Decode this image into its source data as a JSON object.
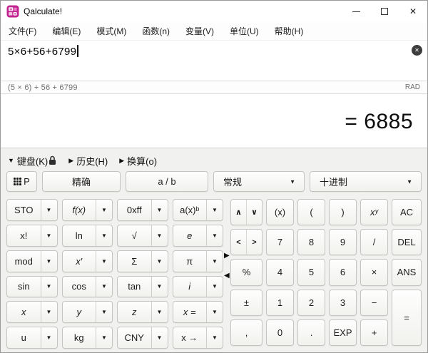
{
  "window": {
    "title": "Qalculate!",
    "controls": {
      "minimize": "–",
      "maximize": "□",
      "close": "✕"
    }
  },
  "menu": [
    "文件(F)",
    "编辑(E)",
    "模式(M)",
    "函数(n)",
    "变量(V)",
    "单位(U)",
    "帮助(H)"
  ],
  "input": {
    "value": "5×6+56+6799",
    "clear_glyph": "✕"
  },
  "statusbar": {
    "parsed": "(5 × 6) + 56 + 6799",
    "angle_mode": "RAD"
  },
  "result": {
    "value": "= 6885"
  },
  "panel": {
    "keyboard_toggle": "键盘(K)",
    "history_toggle": "历史(H)",
    "convert_toggle": "换算(o)"
  },
  "icons": {
    "dropdown_arrow": "▼",
    "expanded_arrow": "▼",
    "collapsed_arrow": "▶",
    "panel_expand_right": "▶",
    "panel_expand_left": "◀"
  },
  "mode_row": {
    "keypad_label": "P",
    "exact": "精确",
    "fraction": "a / b",
    "format": "常规",
    "base": "十进制"
  },
  "left_keypad": [
    {
      "name": "sto",
      "label": "STO"
    },
    {
      "name": "function",
      "label": "f(x)",
      "italic": true
    },
    {
      "name": "hex",
      "label": "0xff"
    },
    {
      "name": "exp-base",
      "label": "a(x)ᵇ"
    },
    {
      "name": "factorial",
      "label": "x!"
    },
    {
      "name": "ln",
      "label": "ln"
    },
    {
      "name": "sqrt",
      "label": "√"
    },
    {
      "name": "e",
      "label": "e",
      "italic": true
    },
    {
      "name": "mod",
      "label": "mod"
    },
    {
      "name": "derivative",
      "label": "x′",
      "italic": true
    },
    {
      "name": "sum",
      "label": "Σ"
    },
    {
      "name": "pi",
      "label": "π"
    },
    {
      "name": "sin",
      "label": "sin"
    },
    {
      "name": "cos",
      "label": "cos"
    },
    {
      "name": "tan",
      "label": "tan"
    },
    {
      "name": "imaginary",
      "label": "i",
      "italic": true
    },
    {
      "name": "var-x",
      "label": "x",
      "italic": true
    },
    {
      "name": "var-y",
      "label": "y",
      "italic": true
    },
    {
      "name": "var-z",
      "label": "z",
      "italic": true
    },
    {
      "name": "solve",
      "label": "x =",
      "italic": true
    },
    {
      "name": "unit-u",
      "label": "u"
    },
    {
      "name": "unit-kg",
      "label": "kg"
    },
    {
      "name": "currency-cny",
      "label": "CNY"
    },
    {
      "name": "convert-to",
      "label": "x →"
    }
  ],
  "right_keypad": [
    {
      "type": "nav",
      "name": "nav-up-down",
      "halves": [
        {
          "name": "nav-up",
          "label": "∧"
        },
        {
          "name": "nav-down",
          "label": "∨"
        }
      ]
    },
    {
      "name": "parenthesize",
      "label": "(x)"
    },
    {
      "name": "paren-open",
      "label": "("
    },
    {
      "name": "paren-close",
      "label": ")"
    },
    {
      "name": "power",
      "label": "xʸ",
      "italic": true
    },
    {
      "name": "ac",
      "label": "AC"
    },
    {
      "type": "nav",
      "name": "nav-left-right",
      "halves": [
        {
          "name": "nav-left",
          "label": "<"
        },
        {
          "name": "nav-right",
          "label": ">"
        }
      ]
    },
    {
      "name": "digit-7",
      "label": "7"
    },
    {
      "name": "digit-8",
      "label": "8"
    },
    {
      "name": "digit-9",
      "label": "9"
    },
    {
      "name": "divide",
      "label": "/"
    },
    {
      "name": "delete",
      "label": "DEL"
    },
    {
      "name": "percent",
      "label": "%"
    },
    {
      "name": "digit-4",
      "label": "4"
    },
    {
      "name": "digit-5",
      "label": "5"
    },
    {
      "name": "digit-6",
      "label": "6"
    },
    {
      "name": "multiply",
      "label": "×"
    },
    {
      "name": "ans",
      "label": "ANS"
    },
    {
      "name": "plus-minus",
      "label": "±"
    },
    {
      "name": "digit-1",
      "label": "1"
    },
    {
      "name": "digit-2",
      "label": "2"
    },
    {
      "name": "digit-3",
      "label": "3"
    },
    {
      "name": "minus",
      "label": "−"
    },
    {
      "name": "equals",
      "label": "=",
      "tall": true
    },
    {
      "name": "comma",
      "label": ","
    },
    {
      "name": "digit-0",
      "label": "0"
    },
    {
      "name": "decimal-point",
      "label": "."
    },
    {
      "name": "exp",
      "label": "EXP"
    },
    {
      "name": "plus",
      "label": "+"
    }
  ]
}
